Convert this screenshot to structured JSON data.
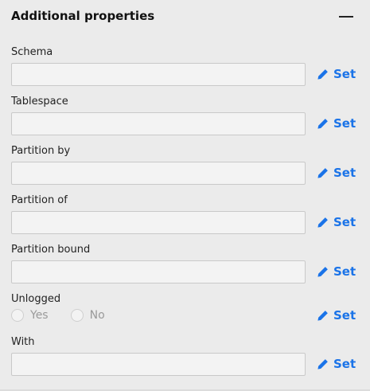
{
  "section": {
    "title": "Additional properties",
    "collapse_icon": "minus-icon"
  },
  "set_label": "Set",
  "accent_color": "#1a73e8",
  "fields": {
    "schema": {
      "label": "Schema",
      "value": ""
    },
    "tablespace": {
      "label": "Tablespace",
      "value": ""
    },
    "partition_by": {
      "label": "Partition by",
      "value": ""
    },
    "partition_of": {
      "label": "Partition of",
      "value": ""
    },
    "partition_bound": {
      "label": "Partition bound",
      "value": ""
    },
    "unlogged": {
      "label": "Unlogged",
      "options": [
        "Yes",
        "No"
      ],
      "selected": ""
    },
    "with": {
      "label": "With",
      "value": ""
    }
  }
}
